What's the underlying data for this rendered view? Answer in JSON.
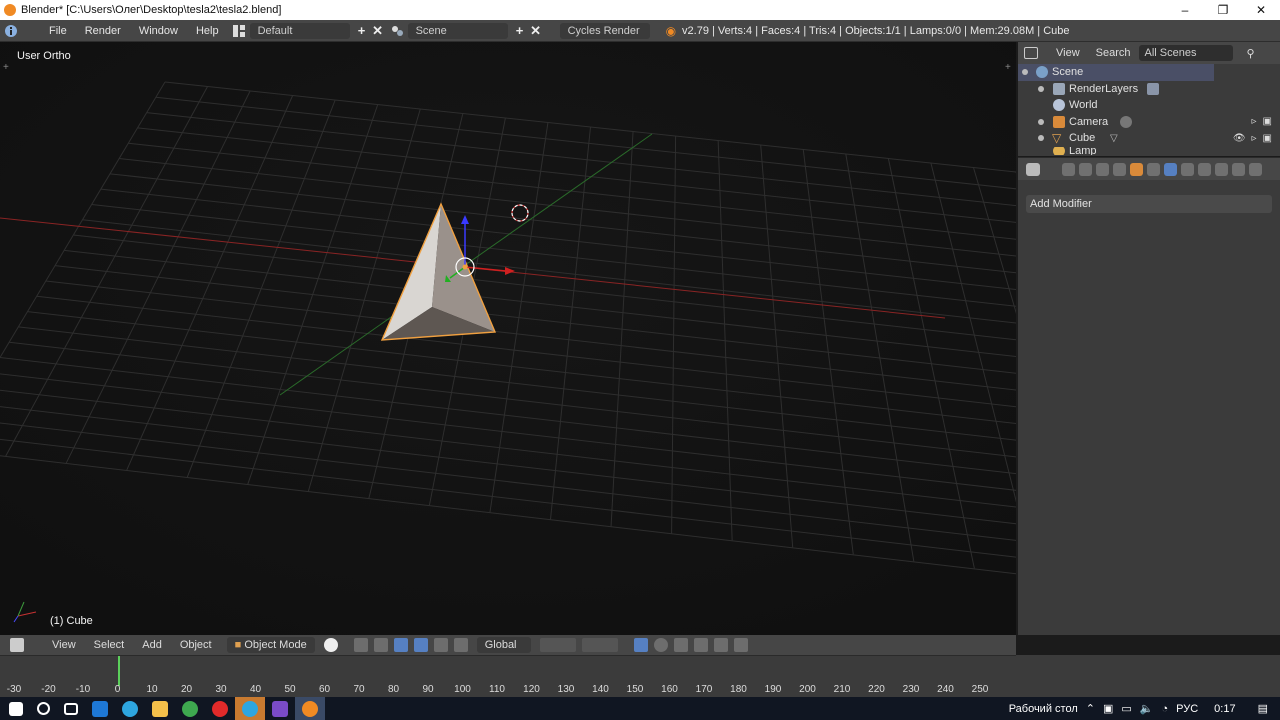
{
  "window": {
    "title": "Blender* [C:\\Users\\Олег\\Desktop\\tesla2\\tesla2.blend]",
    "controls": [
      "–",
      "❐",
      "✕"
    ]
  },
  "info_header": {
    "menus": [
      "File",
      "Render",
      "Window",
      "Help"
    ],
    "screen_layout": "Default",
    "scene": "Scene",
    "render_engine": "Cycles Render",
    "stats": "v2.79 | Verts:4 | Faces:4 | Tris:4 | Objects:1/1 | Lamps:0/0 | Mem:29.08M | Cube"
  },
  "viewport": {
    "view_label": "User Ortho",
    "object_label": "(1) Cube"
  },
  "outliner": {
    "menus": [
      "View",
      "Search"
    ],
    "scenes_filter": "All Scenes",
    "items": [
      {
        "label": "Scene"
      },
      {
        "label": "RenderLayers"
      },
      {
        "label": "World"
      },
      {
        "label": "Camera"
      },
      {
        "label": "Cube"
      },
      {
        "label": "Lamp"
      }
    ]
  },
  "properties": {
    "add_modifier_label": "Add Modifier"
  },
  "view3d_header": {
    "menus": [
      "View",
      "Select",
      "Add",
      "Object"
    ],
    "mode": "Object Mode",
    "orientation": "Global"
  },
  "timeline": {
    "ticks": [
      "-30",
      "-20",
      "-10",
      "0",
      "10",
      "20",
      "30",
      "40",
      "50",
      "60",
      "70",
      "80",
      "90",
      "100",
      "110",
      "120",
      "130",
      "140",
      "150",
      "160",
      "170",
      "180",
      "190",
      "200",
      "210",
      "220",
      "230",
      "240",
      "250"
    ]
  },
  "taskbar": {
    "desktop_label": "Рабочий стол",
    "language": "РУС",
    "time": "0:17"
  },
  "colors": {
    "x_axis": "#c83232",
    "y_axis": "#3c9a3c",
    "selection_outline": "#f0a040",
    "accent_blue": "#5680c2"
  }
}
